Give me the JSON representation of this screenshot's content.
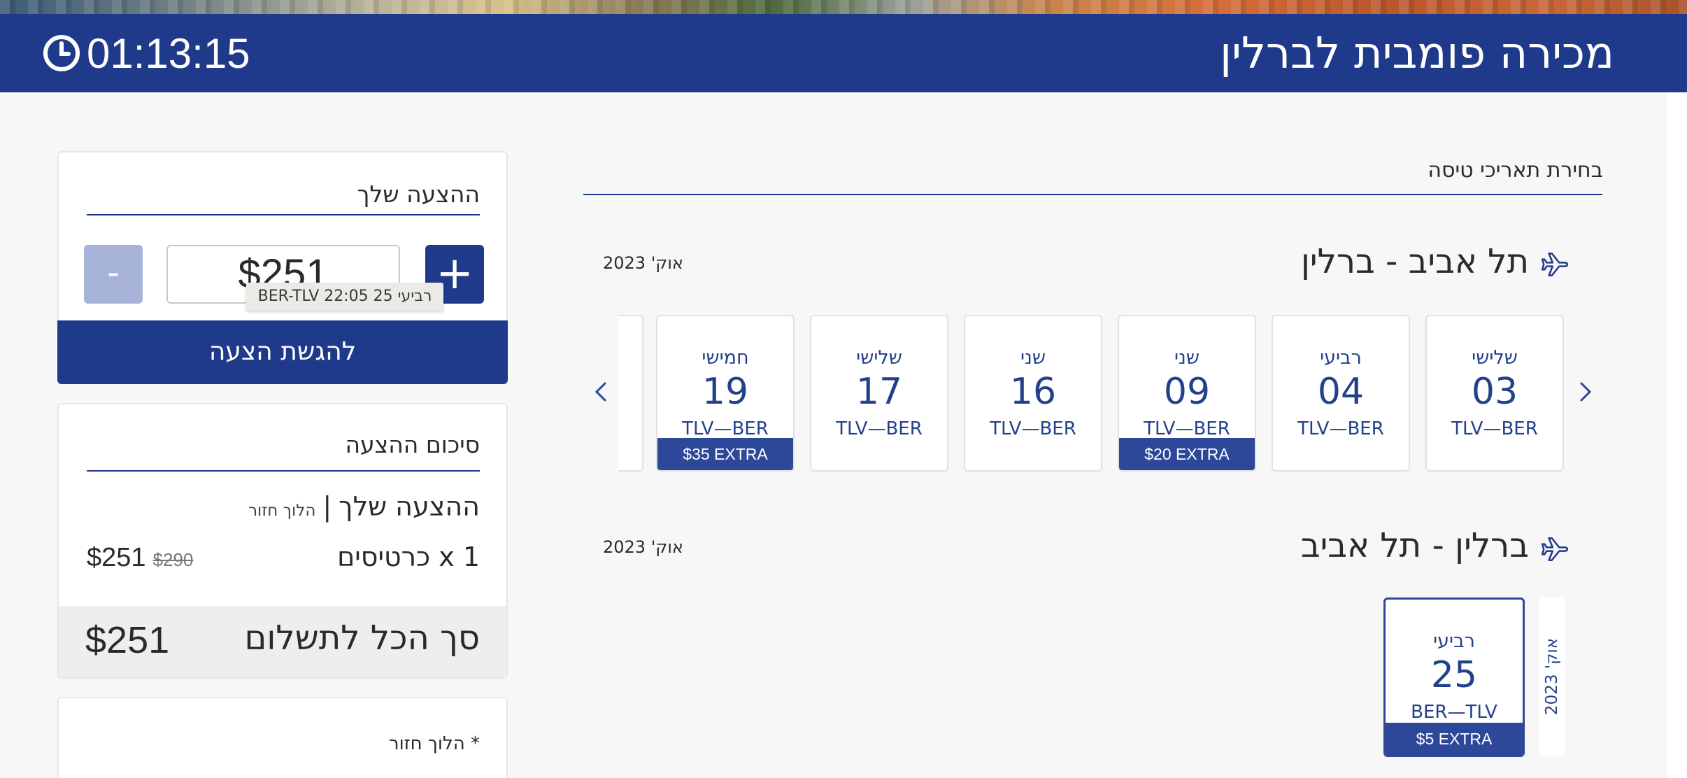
{
  "header": {
    "title": "מכירה פומבית לברלין",
    "timer": "01:13:15",
    "timer_icon": "clock-icon"
  },
  "offer": {
    "heading": "ההצעה שלך",
    "minus_label": "-",
    "plus_label": "+",
    "value": "$251",
    "tooltip": "רביעי 25 BER-TLV 22:05",
    "submit_label": "להגשת הצעה"
  },
  "summary": {
    "heading": "סיכום ההצעה",
    "line1_main": "ההצעה שלך",
    "line1_sep": "|",
    "line1_sub": "הלוך חזור",
    "tickets_label": "1 x כרטיסים",
    "price_new": "$251",
    "price_old": "$290",
    "total_label": "סך הכל לתשלום",
    "total_amount": "$251"
  },
  "note": {
    "text": "* הלוך חזור"
  },
  "dates": {
    "section_title": "בחירת תאריכי טיסה",
    "outbound": {
      "title": "תל אביב - ברלין",
      "month": "אוק' 2023",
      "icon": "plane-icon",
      "cards": [
        {
          "dow": "שלישי",
          "day": "03",
          "route": "TLV—BER",
          "extra": ""
        },
        {
          "dow": "רביעי",
          "day": "04",
          "route": "TLV—BER",
          "extra": ""
        },
        {
          "dow": "שני",
          "day": "09",
          "route": "TLV—BER",
          "extra": "$20  EXTRA"
        },
        {
          "dow": "שני",
          "day": "16",
          "route": "TLV—BER",
          "extra": ""
        },
        {
          "dow": "שלישי",
          "day": "17",
          "route": "TLV—BER",
          "extra": ""
        },
        {
          "dow": "חמישי",
          "day": "19",
          "route": "TLV—BER",
          "extra": "$35  EXTRA"
        }
      ]
    },
    "return": {
      "title": "ברלין - תל אביב",
      "month": "אוק' 2023",
      "icon": "plane-icon",
      "month_vertical": "אוק' 2023",
      "cards": [
        {
          "dow": "רביעי",
          "day": "25",
          "route": "BER—TLV",
          "extra": "$5  EXTRA",
          "selected": true
        }
      ]
    }
  },
  "colors": {
    "brand": "#1f3a8a",
    "card_text": "#23418a",
    "extra_bg": "#2e4899",
    "minus_disabled": "#a7b2d8"
  }
}
